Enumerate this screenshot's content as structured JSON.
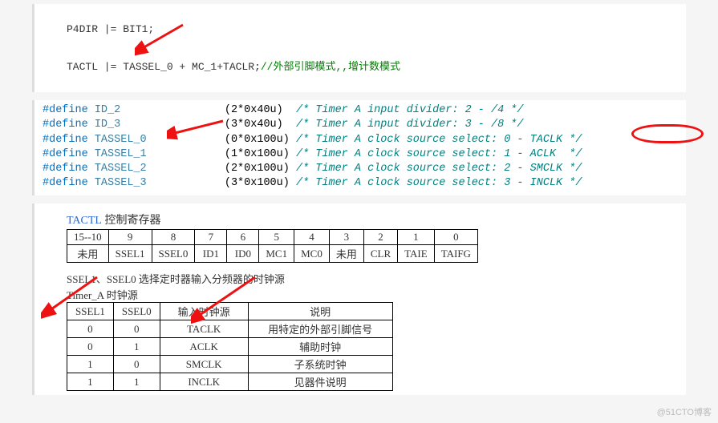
{
  "codeblock1": {
    "line1": "P4DIR |= BIT1;",
    "line2_prefix": "TACTL |= TASSEL_0 + MC_1+TACLR;",
    "line2_comment": "//外部引脚模式,,增计数模式"
  },
  "defines": [
    {
      "kw": "#define",
      "name": "ID_2",
      "val": "(2*0x40u)",
      "comment": "/* Timer A input divider: 2 - /4 */"
    },
    {
      "kw": "#define",
      "name": "ID_3",
      "val": "(3*0x40u)",
      "comment": "/* Timer A input divider: 3 - /8 */"
    },
    {
      "kw": "#define",
      "name": "TASSEL_0",
      "val": "(0*0x100u)",
      "comment": "/* Timer A clock source select: 0 - TACLK */"
    },
    {
      "kw": "#define",
      "name": "TASSEL_1",
      "val": "(1*0x100u)",
      "comment": "/* Timer A clock source select: 1 - ACLK  */"
    },
    {
      "kw": "#define",
      "name": "TASSEL_2",
      "val": "(2*0x100u)",
      "comment": "/* Timer A clock source select: 2 - SMCLK */"
    },
    {
      "kw": "#define",
      "name": "TASSEL_3",
      "val": "(3*0x100u)",
      "comment": "/* Timer A clock source select: 3 - INCLK */"
    }
  ],
  "table1": {
    "title_eng": "TACTL",
    "title_cn": " 控制寄存器",
    "header": [
      "15--10",
      "9",
      "8",
      "7",
      "6",
      "5",
      "4",
      "3",
      "2",
      "1",
      "0"
    ],
    "row": [
      "未用",
      "SSEL1",
      "SSEL0",
      "ID1",
      "ID0",
      "MC1",
      "MC0",
      "未用",
      "CLR",
      "TAIE",
      "TAIFG"
    ]
  },
  "para1": "SSEL1、SSEL0 选择定时器输入分频器的时钟源",
  "subcap": "Timer_A 时钟源",
  "table2": {
    "header": [
      "SSEL1",
      "SSEL0",
      "输入时钟源",
      "说明"
    ],
    "rows": [
      [
        "0",
        "0",
        "TACLK",
        "用特定的外部引脚信号"
      ],
      [
        "0",
        "1",
        "ACLK",
        "辅助时钟"
      ],
      [
        "1",
        "0",
        "SMCLK",
        "子系统时钟"
      ],
      [
        "1",
        "1",
        "INCLK",
        "见器件说明"
      ]
    ]
  },
  "watermark": "@51CTO博客"
}
